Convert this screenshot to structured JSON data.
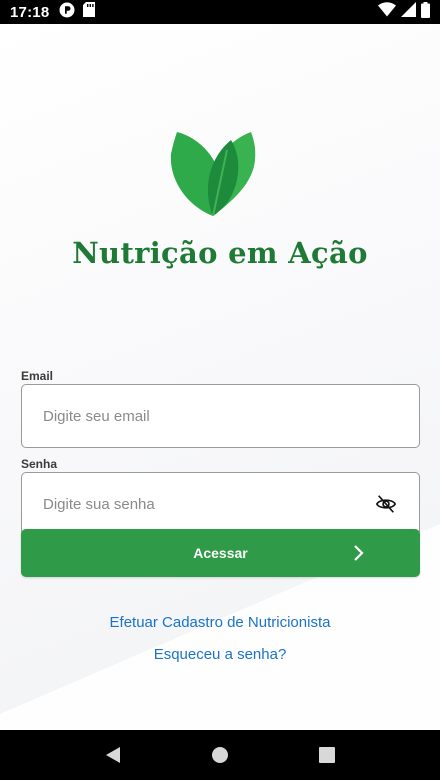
{
  "status_bar": {
    "time": "17:18",
    "left_icons": [
      "app-notification-icon",
      "sd-card-icon"
    ],
    "right_icons": [
      "wifi-icon",
      "signal-icon",
      "battery-icon"
    ]
  },
  "app": {
    "title": "Nutrição em Ação",
    "logo": "leaf-logo",
    "brand_color": "#1f7a35",
    "accent_color": "#2f9a47",
    "link_color": "#1a73c8"
  },
  "form": {
    "email": {
      "label": "Email",
      "placeholder": "Digite seu email",
      "value": ""
    },
    "password": {
      "label": "Senha",
      "placeholder": "Digite sua senha",
      "value": "",
      "toggle_icon": "eye-off-icon"
    },
    "submit_label": "Acessar",
    "submit_icon": "chevron-right-icon"
  },
  "links": {
    "register": "Efetuar Cadastro de Nutricionista",
    "forgot_password": "Esqueceu a senha?"
  },
  "nav_bar": {
    "buttons": [
      "back-icon",
      "home-icon",
      "recents-icon"
    ]
  }
}
